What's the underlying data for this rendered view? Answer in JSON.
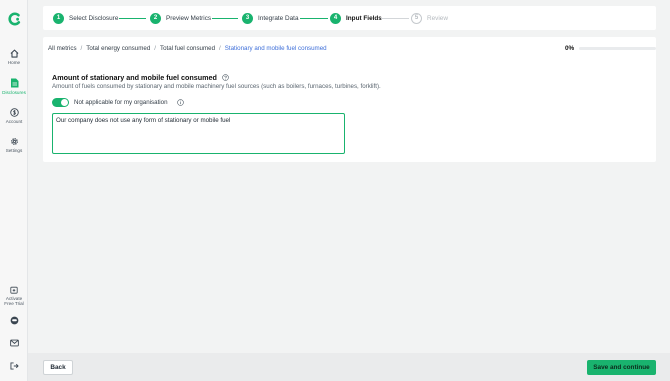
{
  "colors": {
    "accent": "#19b36e",
    "link": "#3e6fd9",
    "pending": "#b5babf"
  },
  "sidebar": {
    "logo_icon": "app-logo-icon",
    "items": [
      {
        "label": "Home",
        "icon": "home-icon"
      },
      {
        "label": "Disclosures",
        "icon": "document-icon",
        "active": true
      },
      {
        "label": "Account",
        "icon": "dollar-circle-icon"
      },
      {
        "label": "Settings",
        "icon": "gear-icon"
      }
    ],
    "trial": {
      "line1": "Activate",
      "line2": "Free Trial",
      "icon": "calendar-add-icon"
    },
    "support_icon": "chat-bubble-icon",
    "mail_icon": "mail-icon",
    "logout_icon": "logout-icon"
  },
  "stepper": {
    "steps": [
      {
        "number": "1",
        "label": "Select Disclosure",
        "status": "done"
      },
      {
        "number": "2",
        "label": "Preview Metrics",
        "status": "done"
      },
      {
        "number": "3",
        "label": "Integrate Data",
        "status": "done"
      },
      {
        "number": "4",
        "label": "Input Fields",
        "status": "current"
      },
      {
        "number": "5",
        "label": "Review",
        "status": "pending"
      }
    ]
  },
  "breadcrumb": [
    "All metrics",
    "Total energy consumed",
    "Total fuel consumed",
    "Stationary and mobile fuel consumed"
  ],
  "progress": {
    "text": "0%",
    "value": 0
  },
  "field": {
    "title": "Amount of stationary and mobile fuel consumed",
    "description": "Amount of fuels consumed by stationary and mobile machinery fuel sources (such as boilers, furnaces, turbines, forklift).",
    "toggle_label": "Not applicable for my organisation",
    "toggle_on": true,
    "textarea_value": "Our company does not use any form of stationary or mobile fuel"
  },
  "footer": {
    "back_label": "Back",
    "save_label": "Save and continue"
  }
}
